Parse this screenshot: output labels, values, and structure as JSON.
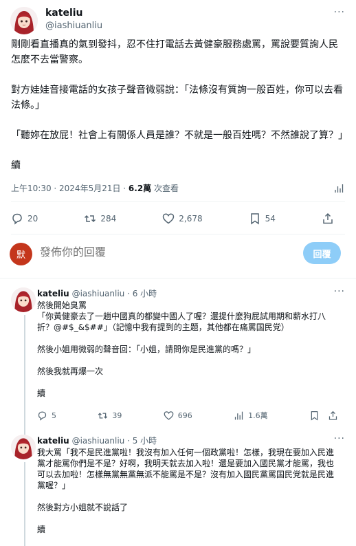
{
  "main_post": {
    "display_name": "kateliu",
    "handle": "@iashiuanliu",
    "more": "···",
    "paragraphs": [
      "剛剛看直播真的氣到發抖，忍不住打電話去黃健豪服務處罵，罵說要質詢人民怎麼不去當警察。",
      "對方娃娃音接電話的女孩子聲音微弱說：「法條沒有質詢一般百姓，你可以去看法條。」",
      "「聽妳在放屁！社會上有關係人員是誰？不就是一般百姓嗎？不然誰說了算？」",
      "續"
    ],
    "time": "上午10:30 · 2024年5月21日 · ",
    "views": "6.2萬",
    "views_label": " 次查看",
    "actions": {
      "replies": "20",
      "reposts": "284",
      "likes": "2,678",
      "bookmarks": "54"
    }
  },
  "reply_box": {
    "avatar_text": "默",
    "placeholder": "發佈你的回覆",
    "button": "回覆"
  },
  "thread": [
    {
      "display_name": "kateliu",
      "handle": "@iashiuanliu",
      "time": " · 6 小時",
      "lines": [
        "然後開始臭罵",
        "「你黃健豪去了一趟中國真的都變中國人了喔？還提什麼狗屁試用期和薪水打八折？@#$_&$##」（記憶中我有提到的主題，其他都在痛罵国民党）",
        "然後小姐用微弱的聲音回：「小姐，請問你是民進黨的嗎？」",
        "然後我就再爆一次",
        "續"
      ],
      "actions": {
        "replies": "5",
        "reposts": "39",
        "likes": "696",
        "views": "1.6萬"
      }
    },
    {
      "display_name": "kateliu",
      "handle": "@iashiuanliu",
      "time": " · 5 小時",
      "lines": [
        "我大罵「我不是民進黨啦！我沒有加入任何一個政黨啦！怎樣，我現在要加入民進黨才能罵你們是不是？好啊，我明天就去加入啦！還是要加入國民黨才能罵，我也可以去加啦！怎樣無黨無黨無派不能罵是不是？沒有加入國民黨罵国民党就是民進黨喔？」",
        "然後對方小姐就不說話了",
        "續"
      ]
    }
  ],
  "colors": {
    "text": "#0f1419",
    "secondary": "#536471",
    "reply_button": "#8ecdf8",
    "reply_avatar": "#c4361c",
    "divider": "#eff3f4"
  }
}
